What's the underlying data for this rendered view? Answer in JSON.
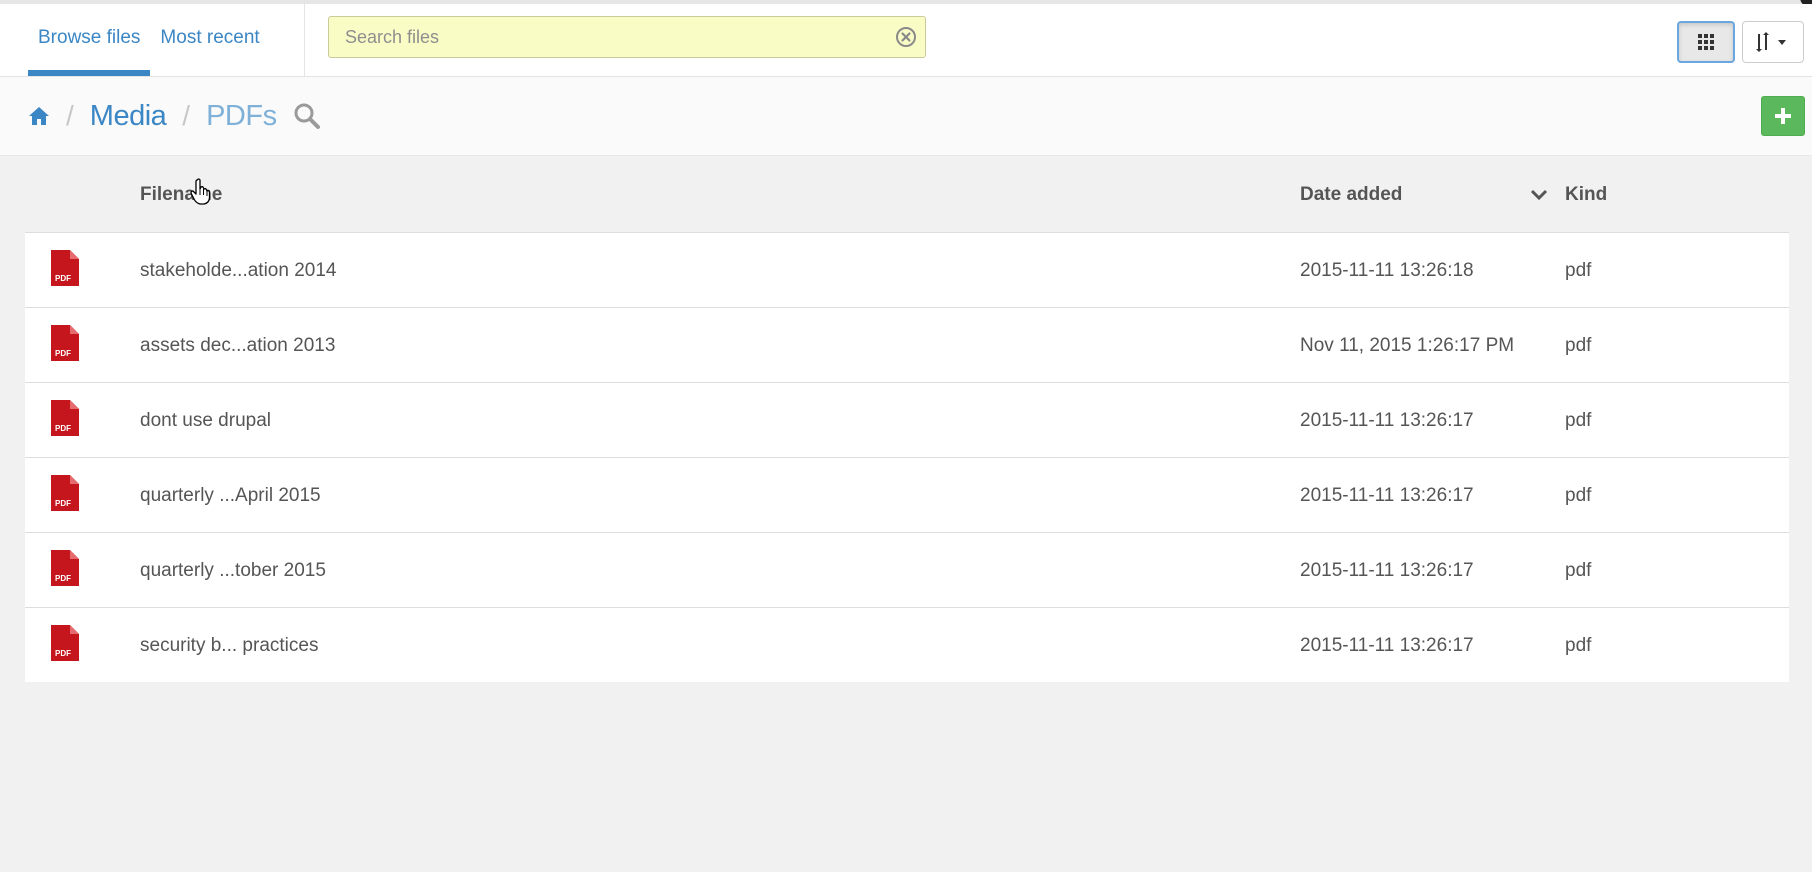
{
  "tabs": [
    {
      "label": "Browse files",
      "active": true
    },
    {
      "label": "Most recent",
      "active": false
    }
  ],
  "search": {
    "placeholder": "Search files",
    "value": ""
  },
  "toolbar": {
    "grid_view_icon": "grid-icon",
    "sort_icon": "sort-icon"
  },
  "breadcrumb": {
    "home_icon": "home-icon",
    "items": [
      "Media",
      "PDFs"
    ],
    "search_icon": "search-icon"
  },
  "add_button_icon": "plus-icon",
  "table": {
    "columns": {
      "filename": "Filename",
      "date_added": "Date added",
      "kind": "Kind"
    },
    "sort_direction": "descending",
    "rows": [
      {
        "name": "stakeholde...ation 2014",
        "date": "2015-11-11 13:26:18",
        "kind": "pdf"
      },
      {
        "name": "assets dec...ation 2013",
        "date": "Nov 11, 2015 1:26:17 PM",
        "kind": "pdf"
      },
      {
        "name": "dont use drupal",
        "date": "2015-11-11 13:26:17",
        "kind": "pdf"
      },
      {
        "name": "quarterly ...April 2015",
        "date": "2015-11-11 13:26:17",
        "kind": "pdf"
      },
      {
        "name": "quarterly ...tober 2015",
        "date": "2015-11-11 13:26:17",
        "kind": "pdf"
      },
      {
        "name": "security b... practices",
        "date": "2015-11-11 13:26:17",
        "kind": "pdf"
      }
    ]
  },
  "colors": {
    "accent": "#3b86c4",
    "search_bg": "#fafcc6",
    "add_button": "#5cb85c",
    "pdf_red": "#c4161c"
  }
}
